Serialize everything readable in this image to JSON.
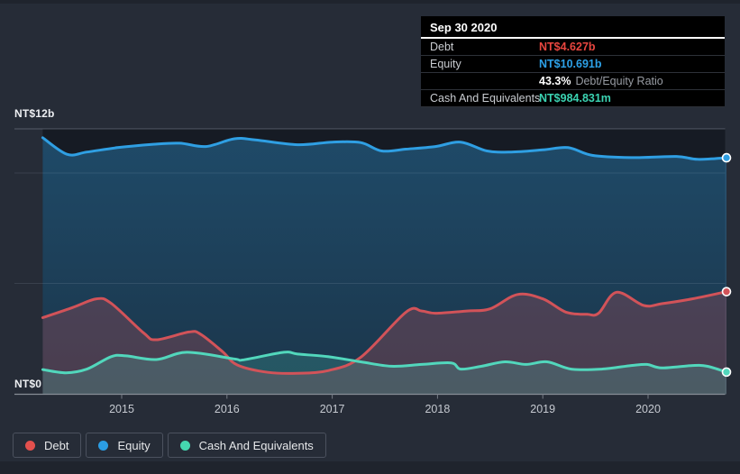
{
  "tooltip": {
    "date": "Sep 30 2020",
    "debt": {
      "label": "Debt",
      "value": "NT$4.627b",
      "color": "#e8463f"
    },
    "equity": {
      "label": "Equity",
      "value": "NT$10.691b",
      "color": "#2da1e8"
    },
    "ratio": {
      "value": "43.3%",
      "label": "Debt/Equity Ratio"
    },
    "cash": {
      "label": "Cash And Equivalents",
      "value": "NT$984.831m",
      "color": "#3bd3b2"
    }
  },
  "legend": {
    "items": [
      {
        "label": "Debt",
        "color": "#e3504d"
      },
      {
        "label": "Equity",
        "color": "#2b9de3"
      },
      {
        "label": "Cash And Equivalents",
        "color": "#45d7b0"
      }
    ]
  },
  "chart_data": {
    "type": "area",
    "x_ticks": [
      "2015",
      "2016",
      "2017",
      "2018",
      "2019",
      "2020"
    ],
    "x_range_years": [
      2014.25,
      2020.745
    ],
    "y_axis": {
      "max_label": "NT$12b",
      "zero_label": "NT$0",
      "max_value_billions": 12,
      "unlabeled_gridlines_billions": [
        10,
        5
      ]
    },
    "unit": "NT$ billions",
    "series": [
      {
        "name": "Debt",
        "color": "#d25359",
        "fill": "rgba(210,83,89,0.26)",
        "end_value": 4.627,
        "points": [
          [
            2014.25,
            3.45
          ],
          [
            2014.53,
            3.9
          ],
          [
            2014.76,
            4.3
          ],
          [
            2014.9,
            4.1
          ],
          [
            2015.21,
            2.75
          ],
          [
            2015.33,
            2.45
          ],
          [
            2015.64,
            2.8
          ],
          [
            2015.75,
            2.7
          ],
          [
            2015.96,
            1.9
          ],
          [
            2016.1,
            1.3
          ],
          [
            2016.39,
            0.97
          ],
          [
            2016.67,
            0.93
          ],
          [
            2016.96,
            1.05
          ],
          [
            2017.27,
            1.65
          ],
          [
            2017.7,
            3.7
          ],
          [
            2017.85,
            3.75
          ],
          [
            2017.98,
            3.65
          ],
          [
            2018.28,
            3.75
          ],
          [
            2018.5,
            3.85
          ],
          [
            2018.76,
            4.5
          ],
          [
            2019.0,
            4.3
          ],
          [
            2019.22,
            3.7
          ],
          [
            2019.42,
            3.6
          ],
          [
            2019.53,
            3.65
          ],
          [
            2019.7,
            4.6
          ],
          [
            2019.96,
            4.0
          ],
          [
            2020.13,
            4.08
          ],
          [
            2020.42,
            4.3
          ],
          [
            2020.745,
            4.627
          ]
        ]
      },
      {
        "name": "Equity",
        "color": "#2f9fe3",
        "fill_top": "rgba(47,159,227,0.36)",
        "fill_bottom": "rgba(47,159,227,0.20)",
        "end_value": 10.691,
        "points": [
          [
            2014.25,
            11.6
          ],
          [
            2014.48,
            10.85
          ],
          [
            2014.67,
            10.95
          ],
          [
            2014.96,
            11.15
          ],
          [
            2015.3,
            11.3
          ],
          [
            2015.55,
            11.35
          ],
          [
            2015.8,
            11.2
          ],
          [
            2016.07,
            11.55
          ],
          [
            2016.27,
            11.5
          ],
          [
            2016.67,
            11.28
          ],
          [
            2017.0,
            11.4
          ],
          [
            2017.27,
            11.38
          ],
          [
            2017.47,
            11.0
          ],
          [
            2017.7,
            11.08
          ],
          [
            2017.98,
            11.2
          ],
          [
            2018.22,
            11.4
          ],
          [
            2018.47,
            11.0
          ],
          [
            2018.7,
            10.95
          ],
          [
            2019.0,
            11.05
          ],
          [
            2019.24,
            11.15
          ],
          [
            2019.47,
            10.8
          ],
          [
            2019.84,
            10.7
          ],
          [
            2020.27,
            10.75
          ],
          [
            2020.47,
            10.62
          ],
          [
            2020.745,
            10.691
          ]
        ]
      },
      {
        "name": "Cash And Equivalents",
        "color": "#52d7bc",
        "fill": "rgba(82,215,188,0.20)",
        "end_value": 0.985,
        "points": [
          [
            2014.25,
            1.1
          ],
          [
            2014.47,
            0.95
          ],
          [
            2014.67,
            1.12
          ],
          [
            2014.9,
            1.68
          ],
          [
            2015.04,
            1.72
          ],
          [
            2015.33,
            1.55
          ],
          [
            2015.62,
            1.88
          ],
          [
            2016.07,
            1.58
          ],
          [
            2016.16,
            1.54
          ],
          [
            2016.54,
            1.88
          ],
          [
            2016.67,
            1.8
          ],
          [
            2016.96,
            1.68
          ],
          [
            2017.27,
            1.45
          ],
          [
            2017.56,
            1.25
          ],
          [
            2017.85,
            1.33
          ],
          [
            2018.13,
            1.4
          ],
          [
            2018.22,
            1.12
          ],
          [
            2018.42,
            1.25
          ],
          [
            2018.64,
            1.45
          ],
          [
            2018.84,
            1.33
          ],
          [
            2019.04,
            1.45
          ],
          [
            2019.27,
            1.12
          ],
          [
            2019.56,
            1.12
          ],
          [
            2019.84,
            1.28
          ],
          [
            2019.99,
            1.33
          ],
          [
            2020.13,
            1.17
          ],
          [
            2020.42,
            1.28
          ],
          [
            2020.56,
            1.25
          ],
          [
            2020.745,
            0.985
          ]
        ]
      }
    ],
    "legend_position": "bottom-left",
    "grid": "horizontal-only"
  }
}
